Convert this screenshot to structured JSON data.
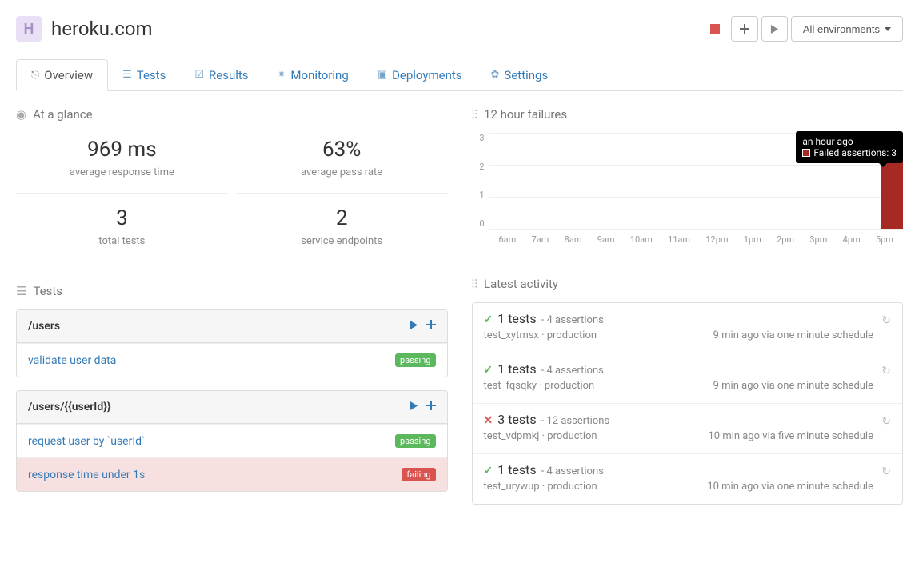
{
  "app": {
    "name": "heroku.com",
    "icon_letter": "H"
  },
  "toolbar": {
    "env_label": "All environments"
  },
  "tabs": {
    "overview": "Overview",
    "tests": "Tests",
    "results": "Results",
    "monitoring": "Monitoring",
    "deployments": "Deployments",
    "settings": "Settings"
  },
  "sections": {
    "glance": "At a glance",
    "failures": "12 hour failures",
    "tests": "Tests",
    "activity": "Latest activity"
  },
  "glance": {
    "avg_response": {
      "value": "969 ms",
      "label": "average response time"
    },
    "pass_rate": {
      "value": "63%",
      "label": "average pass rate"
    },
    "total_tests": {
      "value": "3",
      "label": "total tests"
    },
    "endpoints": {
      "value": "2",
      "label": "service endpoints"
    }
  },
  "chart_data": {
    "type": "bar",
    "categories": [
      "6am",
      "7am",
      "8am",
      "9am",
      "10am",
      "11am",
      "12pm",
      "1pm",
      "2pm",
      "3pm",
      "4pm",
      "5pm"
    ],
    "values": [
      0,
      0,
      0,
      0,
      0,
      0,
      0,
      0,
      0,
      0,
      0,
      3
    ],
    "ylabel": "",
    "ylim": [
      0,
      3
    ],
    "yticks": [
      0,
      1,
      2,
      3
    ],
    "tooltip": {
      "time": "an hour ago",
      "label": "Failed assertions:",
      "value": "3"
    }
  },
  "tests_panel": {
    "groups": [
      {
        "path": "/users",
        "rows": [
          {
            "name": "validate user data",
            "status": "passing"
          }
        ]
      },
      {
        "path": "/users/{{userId}}",
        "rows": [
          {
            "name": "request user by `userId`",
            "status": "passing"
          },
          {
            "name": "response time under 1s",
            "status": "failing"
          }
        ]
      }
    ]
  },
  "activity": {
    "items": [
      {
        "ok": true,
        "tests": "1 tests",
        "assertions": "- 4 assertions",
        "id": "test_xytmsx",
        "env": "production",
        "time": "9 min ago via one minute schedule"
      },
      {
        "ok": true,
        "tests": "1 tests",
        "assertions": "- 4 assertions",
        "id": "test_fqsqky",
        "env": "production",
        "time": "9 min ago via one minute schedule"
      },
      {
        "ok": false,
        "tests": "3 tests",
        "assertions": "- 12 assertions",
        "id": "test_vdpmkj",
        "env": "production",
        "time": "10 min ago via five minute schedule"
      },
      {
        "ok": true,
        "tests": "1 tests",
        "assertions": "- 4 assertions",
        "id": "test_urywup",
        "env": "production",
        "time": "10 min ago via one minute schedule"
      }
    ]
  }
}
